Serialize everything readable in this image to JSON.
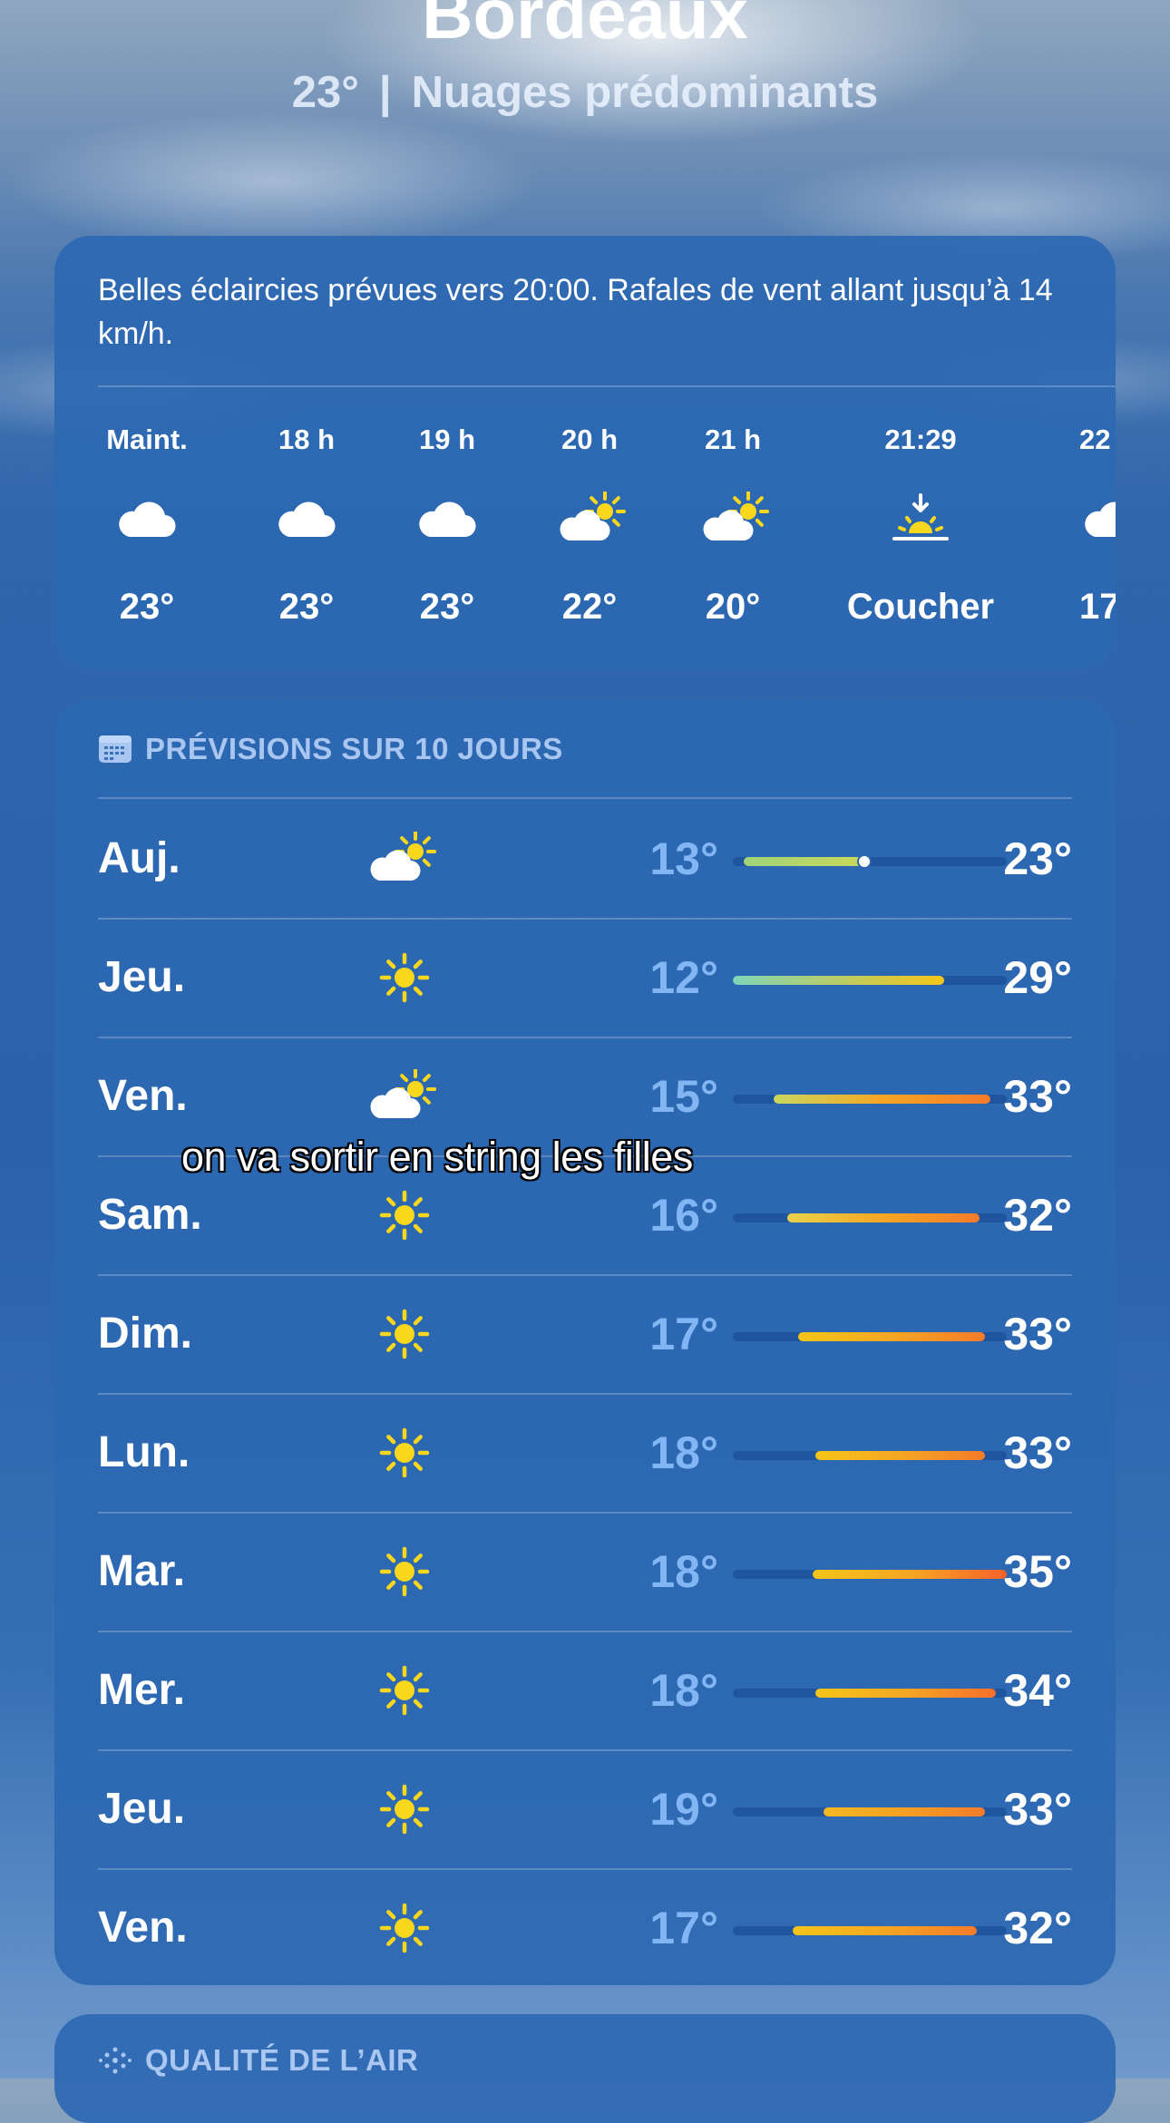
{
  "header": {
    "city": "Bordeaux",
    "current_temp": "23°",
    "separator": "|",
    "condition": "Nuages prédominants"
  },
  "hourly": {
    "summary": "Belles éclaircies prévues vers 20:00. Rafales de vent allant jusqu’à 14 km/h.",
    "items": [
      {
        "time": "Maint.",
        "icon": "cloud-icon",
        "temp": "23°"
      },
      {
        "time": "18 h",
        "icon": "cloud-icon",
        "temp": "23°"
      },
      {
        "time": "19 h",
        "icon": "cloud-icon",
        "temp": "23°"
      },
      {
        "time": "20 h",
        "icon": "partly-sunny-icon",
        "temp": "22°"
      },
      {
        "time": "21 h",
        "icon": "partly-sunny-icon",
        "temp": "20°"
      },
      {
        "time": "21:29",
        "icon": "sunset-icon",
        "temp": "Coucher"
      },
      {
        "time": "22",
        "icon": "cloud-icon",
        "temp": "17"
      }
    ]
  },
  "forecast": {
    "title": "PRÉVISIONS SUR 10 JOURS",
    "days": [
      {
        "day": "Auj.",
        "icon": "partly-sunny-icon",
        "low": "13°",
        "high": "23°",
        "range_start": 0.04,
        "range_end": 0.48,
        "current": 0.48,
        "colors": [
          "#9fd37a",
          "#c9d85a"
        ]
      },
      {
        "day": "Jeu.",
        "icon": "sun-icon",
        "low": "12°",
        "high": "29°",
        "range_start": 0.0,
        "range_end": 0.77,
        "colors": [
          "#7fd4b8",
          "#f5c518"
        ]
      },
      {
        "day": "Ven.",
        "icon": "partly-sunny-icon",
        "low": "15°",
        "high": "33°",
        "range_start": 0.15,
        "range_end": 0.94,
        "colors": [
          "#c9d860",
          "#f5a623",
          "#f57b2a"
        ]
      },
      {
        "day": "Sam.",
        "icon": "sun-icon",
        "low": "16°",
        "high": "32°",
        "range_start": 0.2,
        "range_end": 0.9,
        "colors": [
          "#e9d24a",
          "#f5a623",
          "#f57b2a"
        ]
      },
      {
        "day": "Dim.",
        "icon": "sun-icon",
        "low": "17°",
        "high": "33°",
        "range_start": 0.24,
        "range_end": 0.92,
        "colors": [
          "#f5c518",
          "#f5a623",
          "#f57b2a"
        ]
      },
      {
        "day": "Lun.",
        "icon": "sun-icon",
        "low": "18°",
        "high": "33°",
        "range_start": 0.3,
        "range_end": 0.92,
        "colors": [
          "#f5c518",
          "#f5a623",
          "#f57b2a"
        ]
      },
      {
        "day": "Mar.",
        "icon": "sun-icon",
        "low": "18°",
        "high": "35°",
        "range_start": 0.29,
        "range_end": 1.0,
        "colors": [
          "#f5c518",
          "#f5a623",
          "#f5622a"
        ]
      },
      {
        "day": "Mer.",
        "icon": "sun-icon",
        "low": "18°",
        "high": "34°",
        "range_start": 0.3,
        "range_end": 0.96,
        "colors": [
          "#f5c518",
          "#f5a623",
          "#f56f2a"
        ]
      },
      {
        "day": "Jeu.",
        "icon": "sun-icon",
        "low": "19°",
        "high": "33°",
        "range_start": 0.33,
        "range_end": 0.92,
        "colors": [
          "#f5b823",
          "#f5a023",
          "#f57b2a"
        ]
      },
      {
        "day": "Ven.",
        "icon": "sun-icon",
        "low": "17°",
        "high": "32°",
        "range_start": 0.22,
        "range_end": 0.89,
        "colors": [
          "#f5c518",
          "#f5a623",
          "#f57b2a"
        ]
      }
    ]
  },
  "air_quality": {
    "title": "QUALITÉ DE L’AIR"
  },
  "caption": "on va sortir en string les filles",
  "colors": {
    "sun": "#f9d71c",
    "cloud": "#ffffff"
  }
}
